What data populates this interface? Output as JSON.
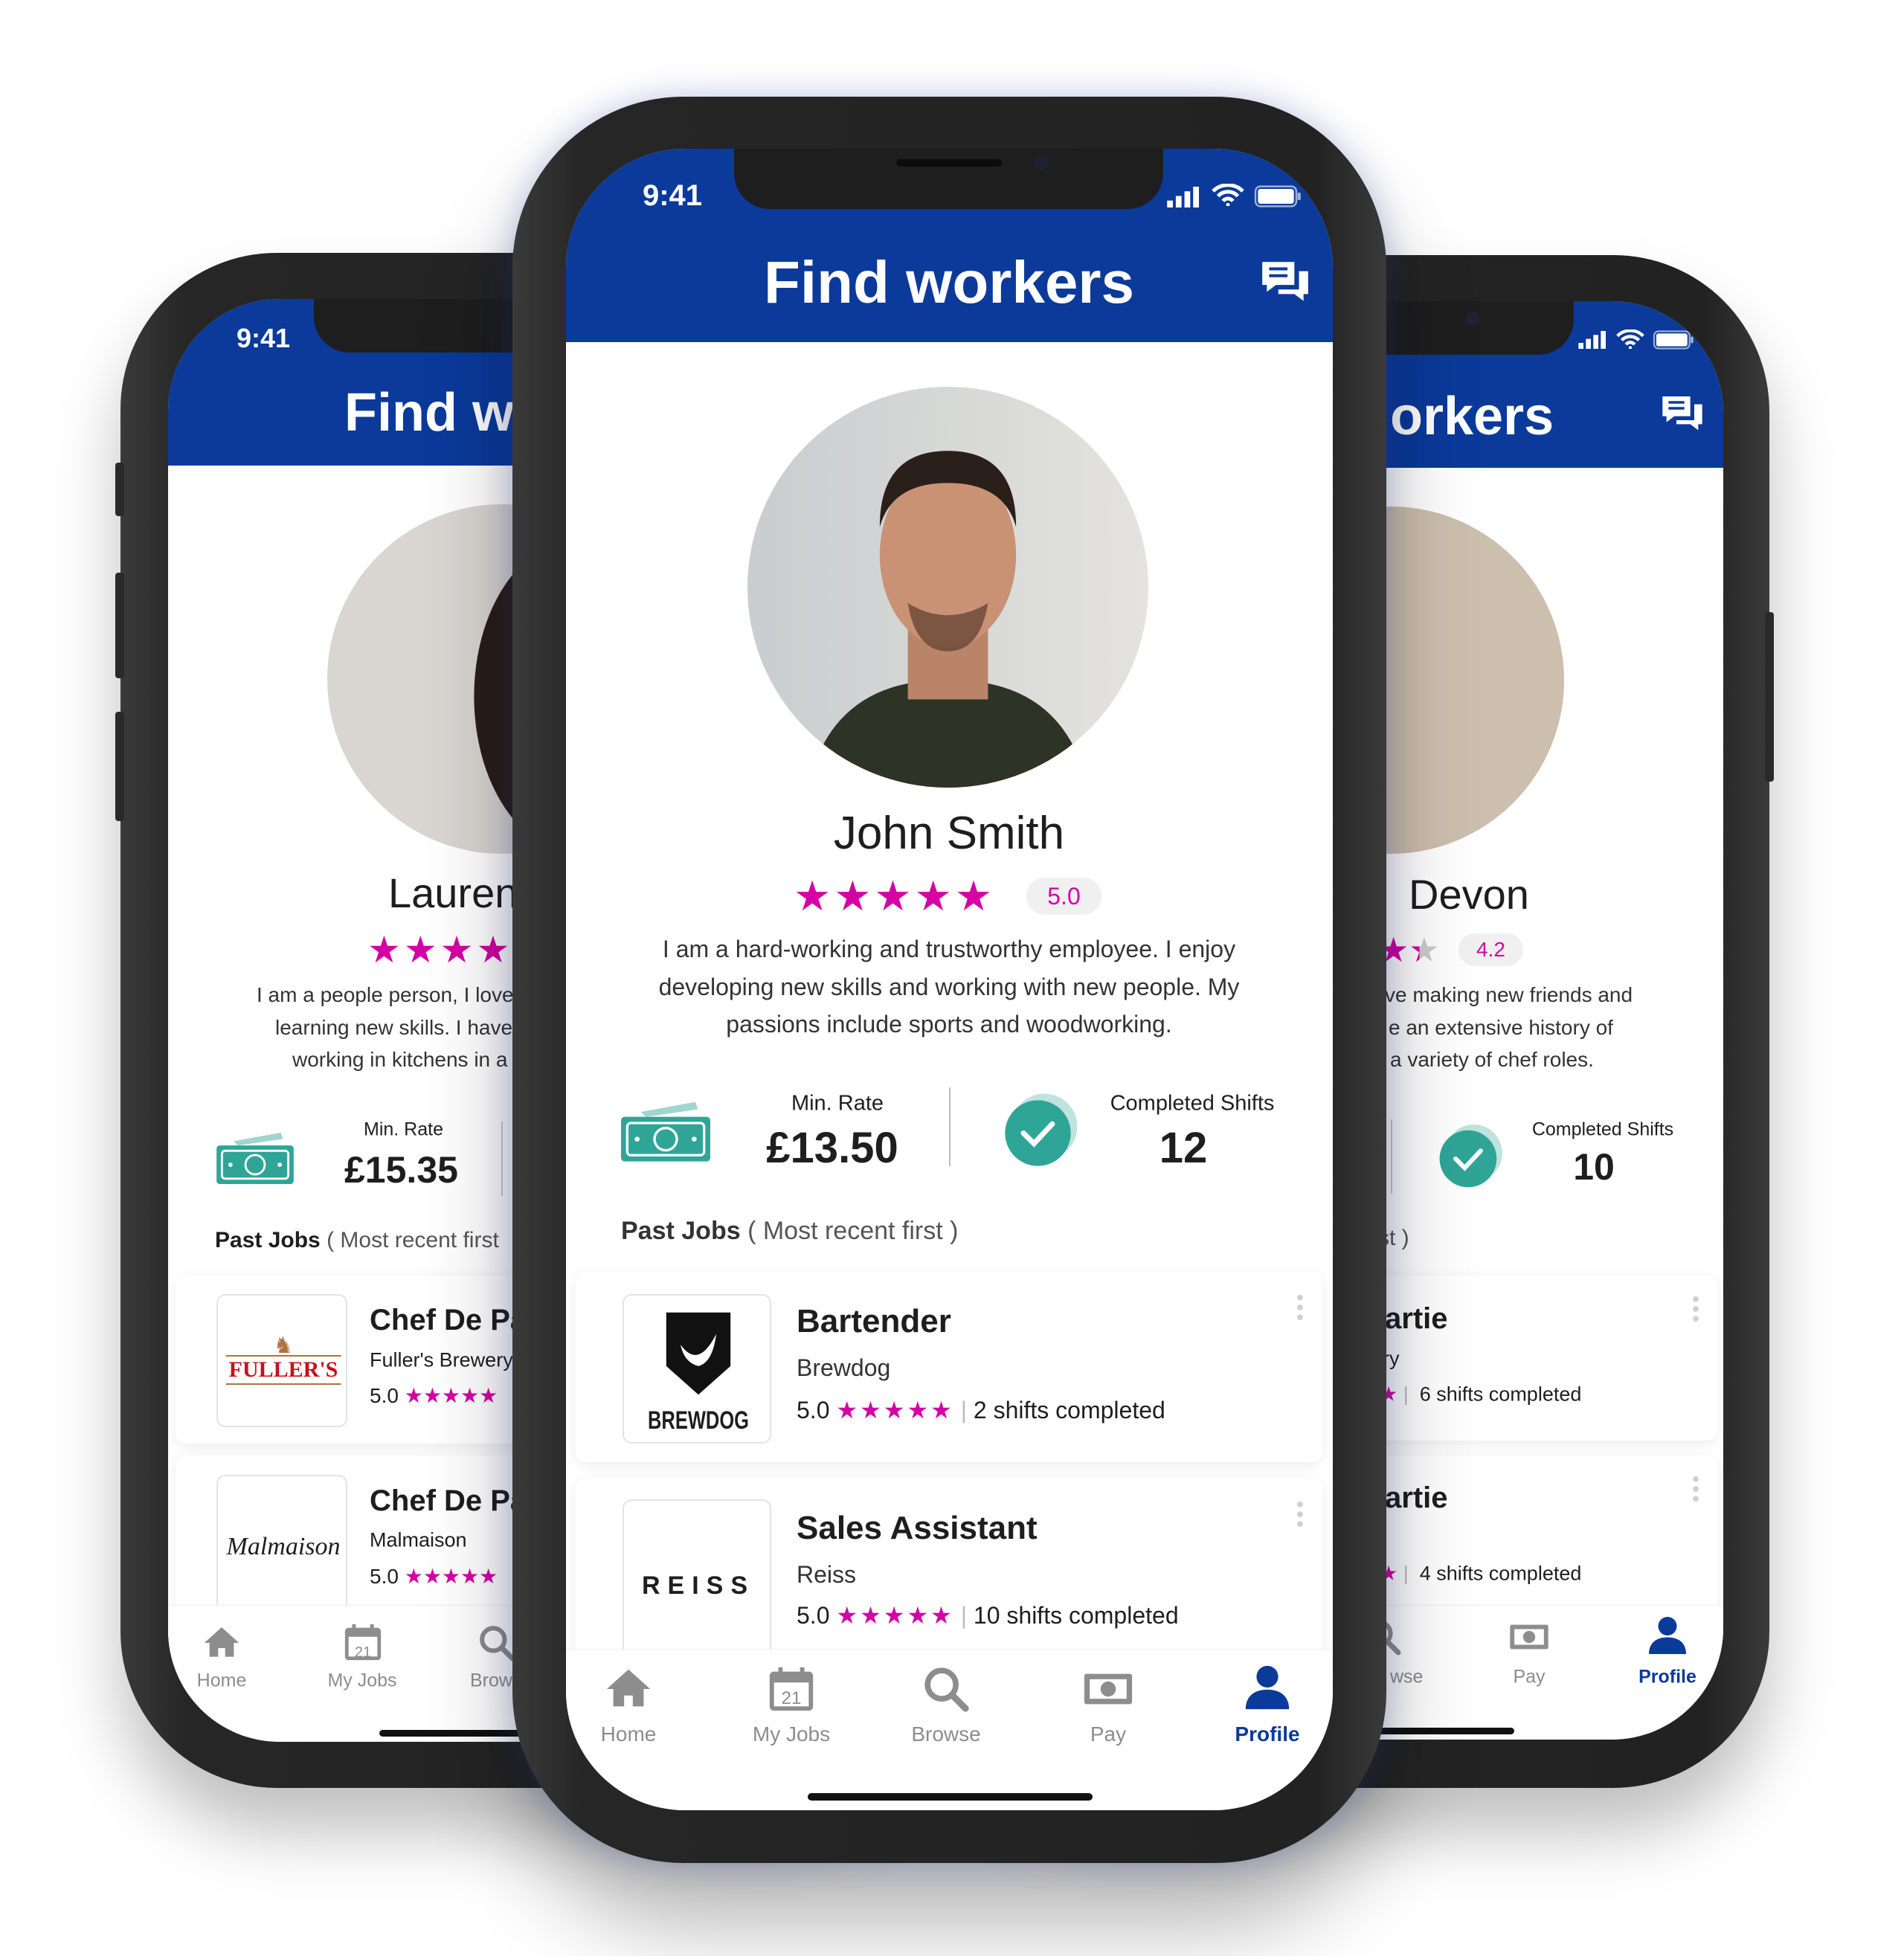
{
  "status_bar": {
    "time": "9:41"
  },
  "colors": {
    "header_blue": "#0b3a9b",
    "star_magenta": "#d400a6",
    "teal": "#2fa597",
    "tab_inactive": "#8d8d8d",
    "tab_active": "#0b3a9b"
  },
  "center": {
    "header_title": "Find workers",
    "name": "John Smith",
    "stars": 5,
    "rating": "5.0",
    "bio": [
      "I am a hard-working and trustworthy employee. I enjoy",
      "developing new skills and working with new people. My",
      "passions include sports and woodworking."
    ],
    "min_rate_label": "Min. Rate",
    "min_rate": "£13.50",
    "completed_label": "Completed Shifts",
    "completed": "12",
    "past_jobs_label": "Past Jobs",
    "past_jobs_note": "( Most recent first )",
    "jobs": [
      {
        "title": "Bartender",
        "company": "Brewdog",
        "rating": "5.0",
        "stars": 5,
        "shifts": "2 shifts completed",
        "logo": "BREWDOG"
      },
      {
        "title": "Sales Assistant",
        "company": "Reiss",
        "rating": "5.0",
        "stars": 5,
        "shifts": "10 shifts completed",
        "logo": "REISS"
      }
    ],
    "tabs": [
      {
        "label": "Home",
        "icon": "home-icon"
      },
      {
        "label": "My Jobs",
        "icon": "calendar-icon",
        "badge": "21"
      },
      {
        "label": "Browse",
        "icon": "search-icon"
      },
      {
        "label": "Pay",
        "icon": "money-icon"
      },
      {
        "label": "Profile",
        "icon": "profile-icon"
      }
    ],
    "active_tab": "Profile"
  },
  "left": {
    "header_title": "Find w",
    "name": "Lauren",
    "stars_visible": 4,
    "bio": [
      "I am a people person, I love",
      "learning new skills. I have",
      "working in kitchens in a"
    ],
    "min_rate_label": "Min. Rate",
    "min_rate": "£15.35",
    "past_jobs_label": "Past Jobs",
    "past_jobs_note": "( Most recent first",
    "jobs": [
      {
        "title": "Chef De Pa",
        "company": "Fuller's Brewery",
        "rating": "5.0",
        "logo": "FULLER'S"
      },
      {
        "title": "Chef De Pa",
        "company": "Malmaison",
        "rating": "5.0",
        "logo": "Malmaison"
      }
    ],
    "tabs": [
      {
        "label": "Home"
      },
      {
        "label": "My Jobs",
        "badge": "21"
      },
      {
        "label": "Brow"
      }
    ]
  },
  "right": {
    "header_title": "orkers",
    "name": "Devon",
    "rating": "4.2",
    "bio": [
      "ve making new friends and",
      "e an extensive history of",
      "a variety of chef roles."
    ],
    "completed_label": "Completed Shifts",
    "completed": "10",
    "past_jobs_note": "st )",
    "jobs": [
      {
        "title": "artie",
        "company": "ry",
        "shifts": "6 shifts completed"
      },
      {
        "title": "artie",
        "shifts": "4 shifts completed"
      }
    ],
    "tabs": [
      {
        "label": "wse"
      },
      {
        "label": "Pay"
      },
      {
        "label": "Profile"
      }
    ],
    "active_tab": "Profile"
  }
}
